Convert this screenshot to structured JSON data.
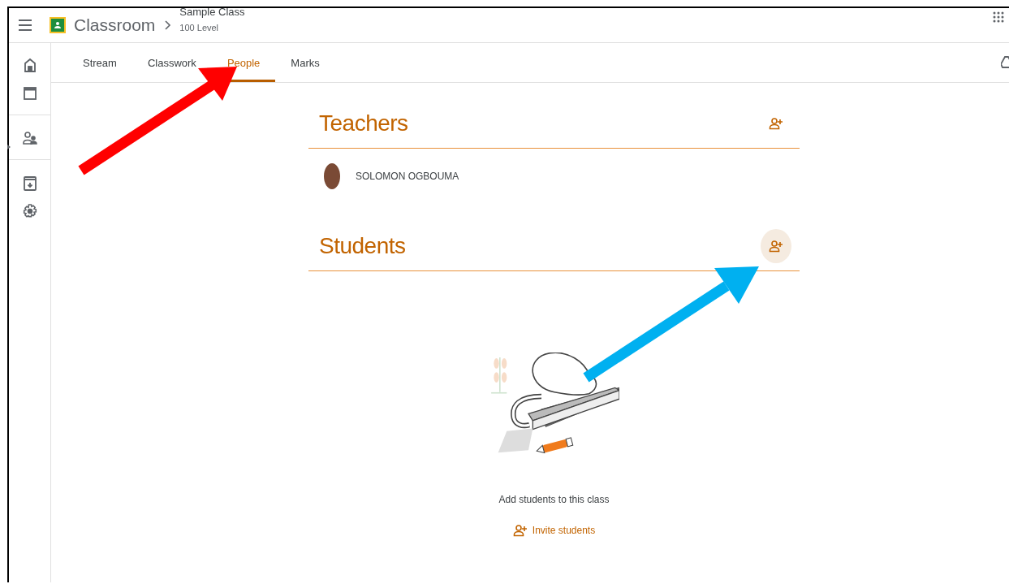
{
  "header": {
    "title": "Classroom",
    "class_name": "Sample Class",
    "class_section": "100 Level"
  },
  "tabs": [
    {
      "label": "Stream",
      "selected": false
    },
    {
      "label": "Classwork",
      "selected": false
    },
    {
      "label": "People",
      "selected": true
    },
    {
      "label": "Marks",
      "selected": false
    }
  ],
  "sections": [
    {
      "title": "Teachers",
      "add_highlighted": false,
      "people": [
        {
          "name": "SOLOMON OGBOUMA"
        }
      ]
    },
    {
      "title": "Students",
      "add_highlighted": true,
      "empty_state": {
        "message": "Add students to this class",
        "action": "Invite students"
      }
    }
  ]
}
